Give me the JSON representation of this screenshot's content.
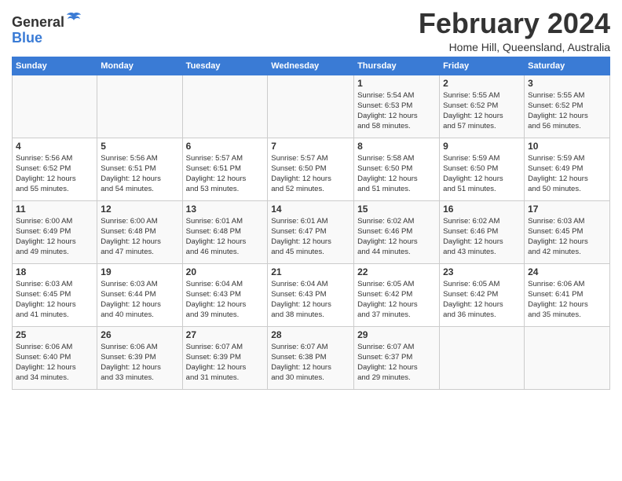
{
  "header": {
    "logo_general": "General",
    "logo_blue": "Blue",
    "month_title": "February 2024",
    "location": "Home Hill, Queensland, Australia"
  },
  "days_of_week": [
    "Sunday",
    "Monday",
    "Tuesday",
    "Wednesday",
    "Thursday",
    "Friday",
    "Saturday"
  ],
  "weeks": [
    [
      {
        "day": "",
        "info": ""
      },
      {
        "day": "",
        "info": ""
      },
      {
        "day": "",
        "info": ""
      },
      {
        "day": "",
        "info": ""
      },
      {
        "day": "1",
        "info": "Sunrise: 5:54 AM\nSunset: 6:53 PM\nDaylight: 12 hours\nand 58 minutes."
      },
      {
        "day": "2",
        "info": "Sunrise: 5:55 AM\nSunset: 6:52 PM\nDaylight: 12 hours\nand 57 minutes."
      },
      {
        "day": "3",
        "info": "Sunrise: 5:55 AM\nSunset: 6:52 PM\nDaylight: 12 hours\nand 56 minutes."
      }
    ],
    [
      {
        "day": "4",
        "info": "Sunrise: 5:56 AM\nSunset: 6:52 PM\nDaylight: 12 hours\nand 55 minutes."
      },
      {
        "day": "5",
        "info": "Sunrise: 5:56 AM\nSunset: 6:51 PM\nDaylight: 12 hours\nand 54 minutes."
      },
      {
        "day": "6",
        "info": "Sunrise: 5:57 AM\nSunset: 6:51 PM\nDaylight: 12 hours\nand 53 minutes."
      },
      {
        "day": "7",
        "info": "Sunrise: 5:57 AM\nSunset: 6:50 PM\nDaylight: 12 hours\nand 52 minutes."
      },
      {
        "day": "8",
        "info": "Sunrise: 5:58 AM\nSunset: 6:50 PM\nDaylight: 12 hours\nand 51 minutes."
      },
      {
        "day": "9",
        "info": "Sunrise: 5:59 AM\nSunset: 6:50 PM\nDaylight: 12 hours\nand 51 minutes."
      },
      {
        "day": "10",
        "info": "Sunrise: 5:59 AM\nSunset: 6:49 PM\nDaylight: 12 hours\nand 50 minutes."
      }
    ],
    [
      {
        "day": "11",
        "info": "Sunrise: 6:00 AM\nSunset: 6:49 PM\nDaylight: 12 hours\nand 49 minutes."
      },
      {
        "day": "12",
        "info": "Sunrise: 6:00 AM\nSunset: 6:48 PM\nDaylight: 12 hours\nand 47 minutes."
      },
      {
        "day": "13",
        "info": "Sunrise: 6:01 AM\nSunset: 6:48 PM\nDaylight: 12 hours\nand 46 minutes."
      },
      {
        "day": "14",
        "info": "Sunrise: 6:01 AM\nSunset: 6:47 PM\nDaylight: 12 hours\nand 45 minutes."
      },
      {
        "day": "15",
        "info": "Sunrise: 6:02 AM\nSunset: 6:46 PM\nDaylight: 12 hours\nand 44 minutes."
      },
      {
        "day": "16",
        "info": "Sunrise: 6:02 AM\nSunset: 6:46 PM\nDaylight: 12 hours\nand 43 minutes."
      },
      {
        "day": "17",
        "info": "Sunrise: 6:03 AM\nSunset: 6:45 PM\nDaylight: 12 hours\nand 42 minutes."
      }
    ],
    [
      {
        "day": "18",
        "info": "Sunrise: 6:03 AM\nSunset: 6:45 PM\nDaylight: 12 hours\nand 41 minutes."
      },
      {
        "day": "19",
        "info": "Sunrise: 6:03 AM\nSunset: 6:44 PM\nDaylight: 12 hours\nand 40 minutes."
      },
      {
        "day": "20",
        "info": "Sunrise: 6:04 AM\nSunset: 6:43 PM\nDaylight: 12 hours\nand 39 minutes."
      },
      {
        "day": "21",
        "info": "Sunrise: 6:04 AM\nSunset: 6:43 PM\nDaylight: 12 hours\nand 38 minutes."
      },
      {
        "day": "22",
        "info": "Sunrise: 6:05 AM\nSunset: 6:42 PM\nDaylight: 12 hours\nand 37 minutes."
      },
      {
        "day": "23",
        "info": "Sunrise: 6:05 AM\nSunset: 6:42 PM\nDaylight: 12 hours\nand 36 minutes."
      },
      {
        "day": "24",
        "info": "Sunrise: 6:06 AM\nSunset: 6:41 PM\nDaylight: 12 hours\nand 35 minutes."
      }
    ],
    [
      {
        "day": "25",
        "info": "Sunrise: 6:06 AM\nSunset: 6:40 PM\nDaylight: 12 hours\nand 34 minutes."
      },
      {
        "day": "26",
        "info": "Sunrise: 6:06 AM\nSunset: 6:39 PM\nDaylight: 12 hours\nand 33 minutes."
      },
      {
        "day": "27",
        "info": "Sunrise: 6:07 AM\nSunset: 6:39 PM\nDaylight: 12 hours\nand 31 minutes."
      },
      {
        "day": "28",
        "info": "Sunrise: 6:07 AM\nSunset: 6:38 PM\nDaylight: 12 hours\nand 30 minutes."
      },
      {
        "day": "29",
        "info": "Sunrise: 6:07 AM\nSunset: 6:37 PM\nDaylight: 12 hours\nand 29 minutes."
      },
      {
        "day": "",
        "info": ""
      },
      {
        "day": "",
        "info": ""
      }
    ]
  ]
}
